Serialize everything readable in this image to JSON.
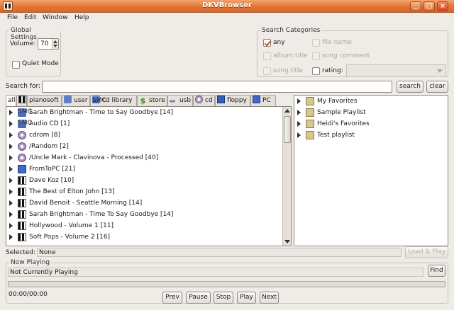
{
  "window": {
    "title": "DKVBrowser",
    "buttons": [
      "_",
      "□",
      "×"
    ]
  },
  "menu": [
    "File",
    "Edit",
    "Window",
    "Help"
  ],
  "global_settings": {
    "title": "Global Settings",
    "volume_label": "Volume:",
    "volume_value": "70",
    "quiet_mode_label": "Quiet Mode",
    "quiet_mode_checked": false
  },
  "search_categories": {
    "title": "Search Categories",
    "options": [
      {
        "label": "any",
        "checked": true,
        "enabled": true
      },
      {
        "label": "file name",
        "checked": false,
        "enabled": false
      },
      {
        "label": "album title",
        "checked": false,
        "enabled": false
      },
      {
        "label": "song comment",
        "checked": false,
        "enabled": false
      },
      {
        "label": "song title",
        "checked": false,
        "enabled": false
      },
      {
        "label": "rating:",
        "checked": false,
        "enabled": true
      }
    ],
    "rating_value": ""
  },
  "search": {
    "label": "Search for:",
    "value": "",
    "search_button": "search",
    "clear_button": "clear"
  },
  "tabs": [
    {
      "label": "all",
      "icon": "none",
      "active": true
    },
    {
      "label": "",
      "icon": "piano-icon",
      "active": false
    },
    {
      "label": "pianosoft",
      "icon": "none",
      "active": false
    },
    {
      "label": "user",
      "icon": "user-icon",
      "active": false
    },
    {
      "label": "cd library",
      "icon": "smc-icon",
      "active": false
    },
    {
      "label": "store",
      "icon": "store-icon",
      "active": false
    },
    {
      "label": "usb",
      "icon": "usb-icon",
      "active": false
    },
    {
      "label": "cd",
      "icon": "cd-icon",
      "active": false
    },
    {
      "label": "floppy",
      "icon": "floppy-icon",
      "active": false
    },
    {
      "label": "PC",
      "icon": "monitor-icon",
      "active": false
    }
  ],
  "library": [
    {
      "label": "Sarah Brightman - Time to Say Goodbye [14]",
      "icon": "smc-icon"
    },
    {
      "label": "Audio CD [1]",
      "icon": "smc-icon"
    },
    {
      "label": "cdrom [8]",
      "icon": "cd-icon"
    },
    {
      "label": "/Random [2]",
      "icon": "cd-icon"
    },
    {
      "label": "/Uncle Mark - Clavinova - Processed [40]",
      "icon": "cd-icon"
    },
    {
      "label": "FromToPC [21]",
      "icon": "monitor-icon"
    },
    {
      "label": "Dave Koz [10]",
      "icon": "piano-icon"
    },
    {
      "label": "The Best of Elton John [13]",
      "icon": "piano-icon"
    },
    {
      "label": "David Benoit - Seattle Morning [14]",
      "icon": "piano-icon"
    },
    {
      "label": "Sarah Brightman - Time To Say Goodbye [14]",
      "icon": "piano-icon"
    },
    {
      "label": "Hollywood - Volume 1 [11]",
      "icon": "piano-icon"
    },
    {
      "label": "Soft Pops - Volume 2 [16]",
      "icon": "piano-icon"
    }
  ],
  "playlists": [
    {
      "label": "My Favorites",
      "icon": "folder-icon"
    },
    {
      "label": "Sample Playlist",
      "icon": "folder-icon"
    },
    {
      "label": "Heidi's Favorites",
      "icon": "folder-icon"
    },
    {
      "label": "Test playlist",
      "icon": "folder-icon"
    }
  ],
  "selected": {
    "label": "Selected:",
    "value": "None",
    "load_play_button": "Load & Play"
  },
  "now_playing": {
    "title": "Now Playing",
    "status": "Not Currently Playing",
    "find_button": "Find",
    "time": "00:00/00:00",
    "progress": 0,
    "controls": [
      "Prev",
      "Pause",
      "Stop",
      "Play",
      "Next"
    ]
  }
}
